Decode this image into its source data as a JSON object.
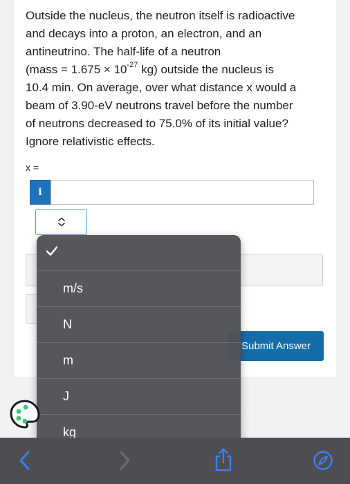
{
  "question": {
    "lines": [
      "Outside the nucleus, the neutron itself is radioactive",
      "and decays into a proton, an electron, and an",
      "antineutrino. The half-life of a neutron",
      "(mass = 1.675 × 10",
      "-27",
      " kg) outside the nucleus is",
      "10.4 min. On average, over what distance x would a",
      "beam of 3.90-eV neutrons travel before the number",
      "of neutrons decreased to 75.0% of its initial value?",
      "Ignore relativistic effects."
    ]
  },
  "answer": {
    "label": "x =",
    "info_glyph": "i",
    "value": ""
  },
  "units_dropdown": {
    "selected_value": "",
    "options": [
      "",
      "m/s",
      "N",
      "m",
      "J",
      "kg"
    ]
  },
  "submit": {
    "label": "Submit Answer"
  },
  "colors": {
    "accent": "#146ca8",
    "info": "#1e73be",
    "dropdown_bg": "#525256",
    "toolbar_bg": "#4e4e52",
    "safari_blue": "#3b82f6"
  },
  "icons": {
    "check": "check-icon",
    "palette": "palette-icon",
    "back": "chevron-left-icon",
    "forward": "chevron-right-icon",
    "share": "share-icon",
    "compass": "compass-icon"
  }
}
